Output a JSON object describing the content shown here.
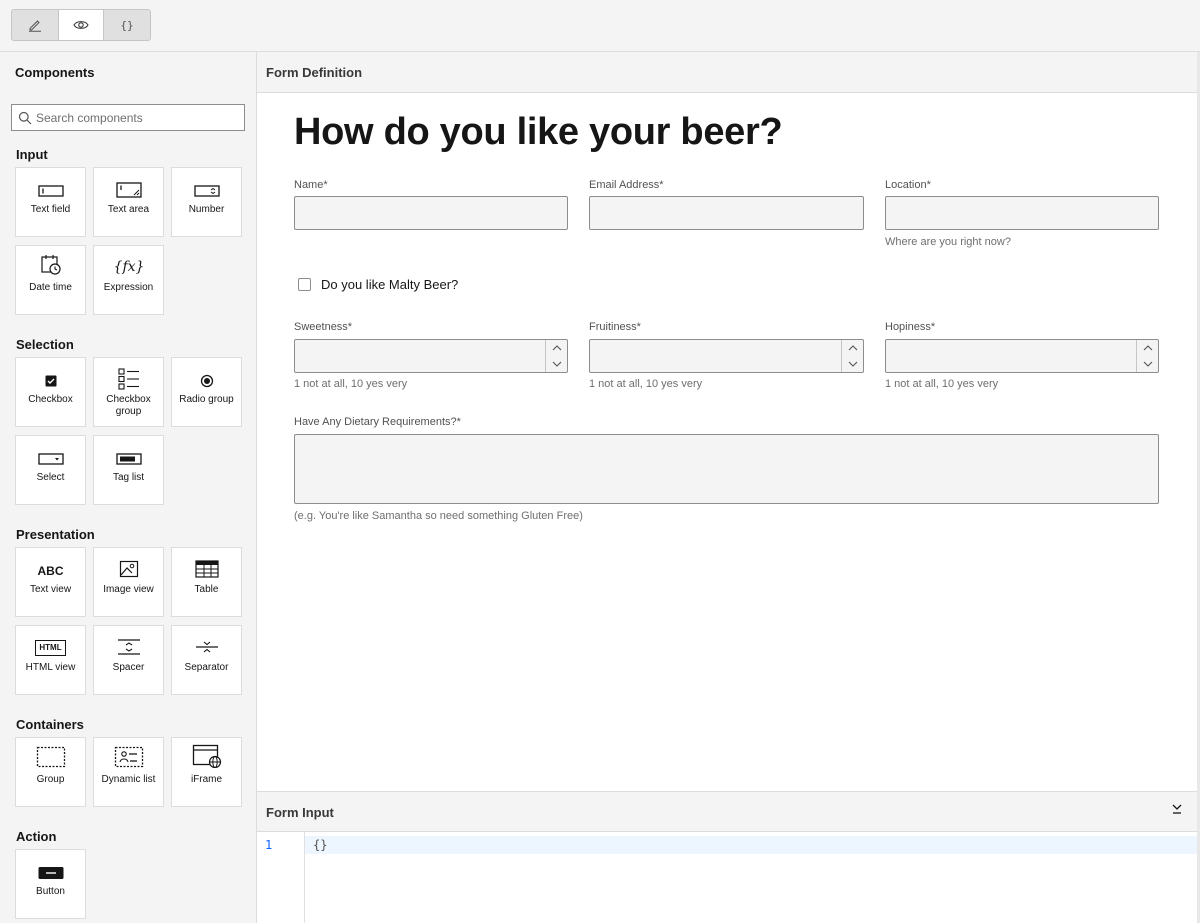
{
  "toolbar": {
    "modes": [
      {
        "name": "edit",
        "icon": "pencil-icon"
      },
      {
        "name": "preview",
        "icon": "eye-icon"
      },
      {
        "name": "json",
        "icon": "braces-icon",
        "glyph": "{}"
      }
    ],
    "active_mode": "preview"
  },
  "palette": {
    "title": "Components",
    "search_placeholder": "Search components",
    "groups": {
      "input": {
        "title": "Input",
        "items": [
          "Text field",
          "Text area",
          "Number",
          "Date time",
          "Expression"
        ]
      },
      "selection": {
        "title": "Selection",
        "items": [
          "Checkbox",
          "Checkbox group",
          "Radio group",
          "Select",
          "Tag list"
        ]
      },
      "presentation": {
        "title": "Presentation",
        "items": [
          "Text view",
          "Image view",
          "Table",
          "HTML view",
          "Spacer",
          "Separator"
        ],
        "text_view_glyph": "ABC",
        "html_view_glyph": "HTML"
      },
      "containers": {
        "title": "Containers",
        "items": [
          "Group",
          "Dynamic list",
          "iFrame"
        ]
      },
      "action": {
        "title": "Action",
        "items": [
          "Button"
        ]
      }
    }
  },
  "form_definition": {
    "header": "Form Definition",
    "title": "How do you like your beer?",
    "fields": {
      "name": {
        "label": "Name*"
      },
      "email": {
        "label": "Email Address*"
      },
      "location": {
        "label": "Location*",
        "help": "Where are you right now?"
      },
      "malty": {
        "label": "Do you like Malty Beer?",
        "checked": false
      },
      "sweetness": {
        "label": "Sweetness*",
        "help": "1 not at all, 10 yes very"
      },
      "fruitiness": {
        "label": "Fruitiness*",
        "help": "1 not at all, 10 yes very"
      },
      "hopiness": {
        "label": "Hopiness*",
        "help": "1 not at all, 10 yes very"
      },
      "dietary": {
        "label": "Have Any Dietary Requirements?*",
        "help": "(e.g. You're like Samantha so need something Gluten Free)"
      }
    }
  },
  "form_input": {
    "header": "Form Input",
    "line_number": "1",
    "code": "{}"
  },
  "colors": {
    "accent": "#0f62fe",
    "panel_bg": "#f4f4f4",
    "border": "#dcdcdc"
  }
}
